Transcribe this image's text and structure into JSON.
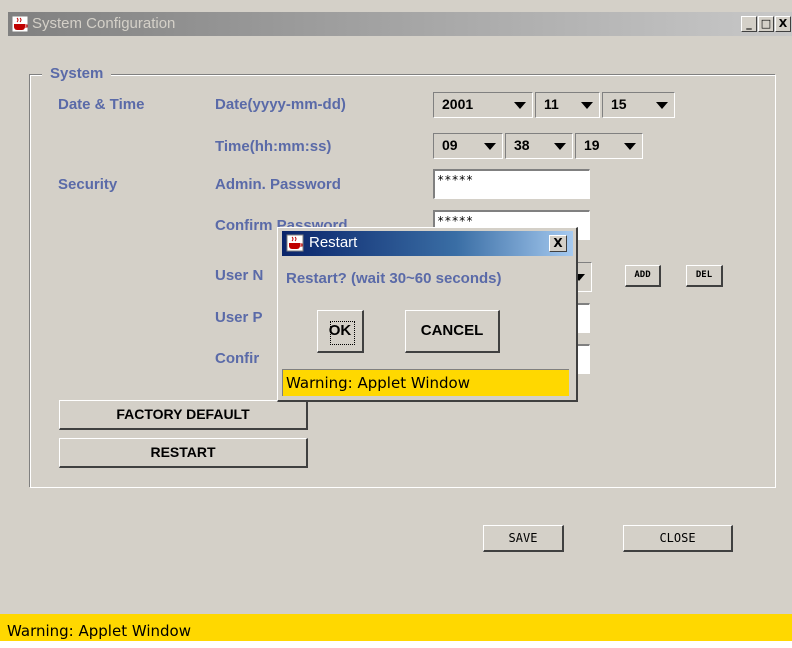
{
  "window": {
    "title": "System Configuration"
  },
  "titlebar_buttons": {
    "minimize": "_",
    "maximize": "□",
    "close": "X"
  },
  "group": {
    "title": "System"
  },
  "labels": {
    "date_time": "Date & Time",
    "date_format": "Date(yyyy-mm-dd)",
    "time_format": "Time(hh:mm:ss)",
    "security": "Security",
    "admin_password": "Admin. Password",
    "confirm_password": "Confirm Password",
    "user_name_partial": "User N",
    "user_password_partial": "User P",
    "confirm_partial": "Confir"
  },
  "date": {
    "year": "2001",
    "month": "11",
    "day": "15"
  },
  "time": {
    "hour": "09",
    "minute": "38",
    "second": "19"
  },
  "fields": {
    "admin_password": "*****",
    "confirm_password": "*****"
  },
  "buttons": {
    "add": "ADD",
    "del": "DEL",
    "factory_default": "FACTORY DEFAULT",
    "restart": "RESTART",
    "save": "SAVE",
    "close": "CLOSE"
  },
  "warning": "Warning: Applet Window",
  "dialog": {
    "title": "Restart",
    "close": "X",
    "message": "Restart? (wait 30~60 seconds)",
    "ok": "OK",
    "cancel": "CANCEL",
    "warning": "Warning: Applet Window"
  }
}
